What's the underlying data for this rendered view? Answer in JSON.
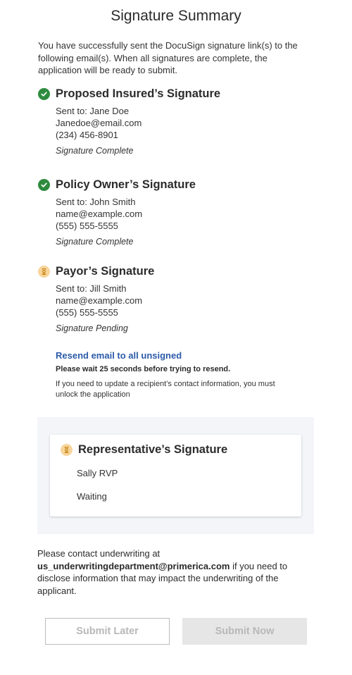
{
  "page": {
    "title": "Signature Summary",
    "intro": "You have successfully sent the DocuSign signature link(s) to the following email(s). When all signatures are complete, the application will be ready to submit."
  },
  "signatures": [
    {
      "title": "Proposed Insured’s Signature",
      "sent_to": "Sent to: Jane Doe",
      "email": "Janedoe@email.com",
      "phone": "(234) 456-8901",
      "status": "Signature Complete",
      "icon": "check-circle-icon"
    },
    {
      "title": "Policy Owner’s Signature",
      "sent_to": "Sent to: John Smith",
      "email": "name@example.com",
      "phone": "(555) 555-5555",
      "status": "Signature Complete",
      "icon": "check-circle-icon"
    },
    {
      "title": "Payor’s Signature",
      "sent_to": "Sent to: Jill Smith",
      "email": "name@example.com",
      "phone": "(555) 555-5555",
      "status": "Signature Pending",
      "icon": "hourglass-icon"
    }
  ],
  "resend": {
    "link_label": "Resend email to all unsigned",
    "wait_note": "Please wait 25 seconds before trying to resend.",
    "unlock_note": "If you need to update a recipient’s contact information, you must unlock the application"
  },
  "representative": {
    "title": "Representative’s Signature",
    "name": "Sally RVP",
    "status": "Waiting",
    "icon": "hourglass-icon"
  },
  "contact": {
    "prefix": "Please contact underwriting at",
    "email": "us_underwritingdepartment@primerica.com",
    "suffix": " if you need to disclose information that may impact the underwriting of the applicant."
  },
  "actions": {
    "submit_later": "Submit Later",
    "submit_now": "Submit Now"
  },
  "colors": {
    "complete": "#2e8b3e",
    "pending": "#f7d59b",
    "link": "#2b5aa8",
    "panel_bg": "#f3f5f9",
    "disabled_text": "#b8b8b8"
  }
}
